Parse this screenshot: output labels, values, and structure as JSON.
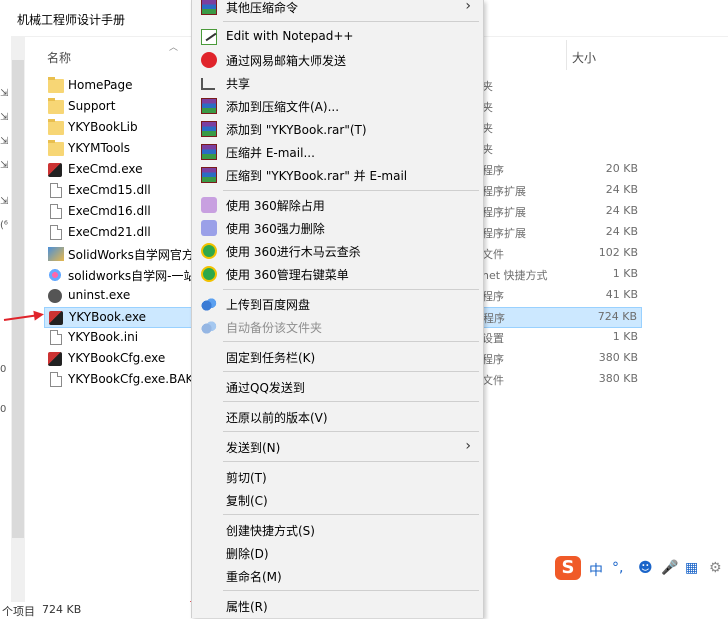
{
  "explorer": {
    "path": "机械工程师设计手册",
    "columns": {
      "name": "名称",
      "size": "大小"
    },
    "files": [
      {
        "name": "HomePage",
        "icon": "folder-icon",
        "type": "夹",
        "size": ""
      },
      {
        "name": "Support",
        "icon": "folder-icon",
        "type": "夹",
        "size": ""
      },
      {
        "name": "YKYBookLib",
        "icon": "folder-icon",
        "type": "夹",
        "size": ""
      },
      {
        "name": "YKYMTools",
        "icon": "folder-icon",
        "type": "夹",
        "size": ""
      },
      {
        "name": "ExeCmd.exe",
        "icon": "exe-icon",
        "type": "程序",
        "size": "20 KB"
      },
      {
        "name": "ExeCmd15.dll",
        "icon": "dll-icon",
        "type": "程序扩展",
        "size": "24 KB"
      },
      {
        "name": "ExeCmd16.dll",
        "icon": "dll-icon",
        "type": "程序扩展",
        "size": "24 KB"
      },
      {
        "name": "ExeCmd21.dll",
        "icon": "dll-icon",
        "type": "程序扩展",
        "size": "24 KB"
      },
      {
        "name": "SolidWorks自学网官方",
        "icon": "image-icon",
        "type": "文件",
        "size": "102 KB"
      },
      {
        "name": "solidworks自学网-一站",
        "icon": "shortcut-icon",
        "type": "net 快捷方式",
        "size": "1 KB"
      },
      {
        "name": "uninst.exe",
        "icon": "uninstaller-icon",
        "type": "程序",
        "size": "41 KB"
      },
      {
        "name": "YKYBook.exe",
        "icon": "exe-icon",
        "type": "程序",
        "size": "724 KB",
        "selected": true
      },
      {
        "name": "YKYBook.ini",
        "icon": "ini-icon",
        "type": "设置",
        "size": "1 KB"
      },
      {
        "name": "YKYBookCfg.exe",
        "icon": "cfg-exe-icon",
        "type": "程序",
        "size": "380 KB"
      },
      {
        "name": "YKYBookCfg.exe.BAK",
        "icon": "file-icon",
        "type": "文件",
        "size": "380 KB"
      }
    ],
    "status": {
      "items": "个项目",
      "size": "724 KB"
    },
    "left_glyphs": [
      "⇲",
      "⇲",
      "⇲",
      "⇲",
      "⇲",
      "(⁶",
      "0",
      "0"
    ]
  },
  "context_menu": {
    "items": [
      {
        "label": "其他压缩命令",
        "icon": "winrar-icon",
        "submenu": true
      },
      {
        "label": "Edit with Notepad++",
        "icon": "notepadpp-icon"
      },
      {
        "label": "通过网易邮箱大师发送",
        "icon": "netease-mail-icon"
      },
      {
        "label": "共享",
        "icon": "share-icon"
      },
      {
        "label": "添加到压缩文件(A)...",
        "icon": "winrar-icon"
      },
      {
        "label": "添加到 \"YKYBook.rar\"(T)",
        "icon": "winrar-icon"
      },
      {
        "label": "压缩并 E-mail...",
        "icon": "winrar-icon"
      },
      {
        "label": "压缩到 \"YKYBook.rar\" 并 E-mail",
        "icon": "winrar-icon"
      },
      {
        "label": "使用 360解除占用",
        "icon": "360-unlock-icon"
      },
      {
        "label": "使用 360强力删除",
        "icon": "360-delete-icon"
      },
      {
        "label": "使用 360进行木马云查杀",
        "icon": "360-scan-icon"
      },
      {
        "label": "使用 360管理右键菜单",
        "icon": "360-menu-icon"
      },
      {
        "label": "上传到百度网盘",
        "icon": "baidu-cloud-icon"
      },
      {
        "label": "自动备份该文件夹",
        "icon": "baidu-cloud-icon",
        "disabled": true
      },
      {
        "label": "固定到任务栏(K)",
        "icon": ""
      },
      {
        "label": "通过QQ发送到",
        "icon": ""
      },
      {
        "label": "还原以前的版本(V)",
        "icon": ""
      },
      {
        "label": "发送到(N)",
        "icon": "",
        "submenu": true
      },
      {
        "label": "剪切(T)",
        "icon": ""
      },
      {
        "label": "复制(C)",
        "icon": ""
      },
      {
        "label": "创建快捷方式(S)",
        "icon": ""
      },
      {
        "label": "删除(D)",
        "icon": ""
      },
      {
        "label": "重命名(M)",
        "icon": ""
      },
      {
        "label": "属性(R)",
        "icon": ""
      }
    ],
    "submenu_glyph": "›"
  },
  "ime_toolbar": {
    "logo": "S",
    "lang": "中",
    "punct": "°,",
    "emoji": "☻",
    "mic": "🎤",
    "keyboard": "▦",
    "skin": "⚙"
  },
  "colors": {
    "accent_red": "#e0242b",
    "selection": "#cce8ff",
    "menu_bg": "#f2f2f2"
  }
}
